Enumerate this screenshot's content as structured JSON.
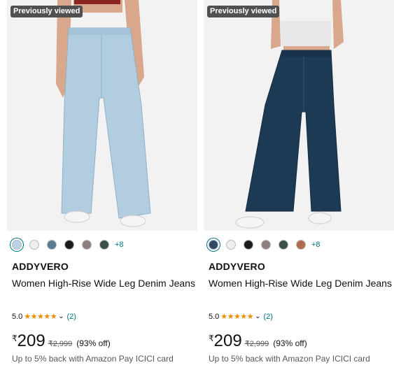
{
  "products": [
    {
      "badge": "Previously viewed",
      "brand": "ADDYVERO",
      "title": "Women High-Rise Wide Leg Denim Jeans",
      "rating": "5.0",
      "review_count": "(2)",
      "currency": "₹",
      "price": "209",
      "mrp": "2,999",
      "discount": "(93% off)",
      "cashback": "Up to 5% back with Amazon Pay ICICI card",
      "swatch_colors": [
        "#b9d3e8",
        "#eeeeee",
        "#5a7a92",
        "#1c1c1c",
        "#8d7f7d",
        "#3a5048"
      ],
      "more_colors": "+8",
      "jeans_color": "#b3cde0",
      "top_color": "#8b2323"
    },
    {
      "badge": "Previously viewed",
      "brand": "ADDYVERO",
      "title": "Women High-Rise Wide Leg Denim Jeans",
      "rating": "5.0",
      "review_count": "(2)",
      "currency": "₹",
      "price": "209",
      "mrp": "2,999",
      "discount": "(93% off)",
      "cashback": "Up to 5% back with Amazon Pay ICICI card",
      "swatch_colors": [
        "#2f4a66",
        "#eeeeee",
        "#1c1c1c",
        "#8d7f7d",
        "#3a5048",
        "#b06a50"
      ],
      "more_colors": "+8",
      "jeans_color": "#1d3a55",
      "top_color": "#e8e8e8"
    }
  ]
}
